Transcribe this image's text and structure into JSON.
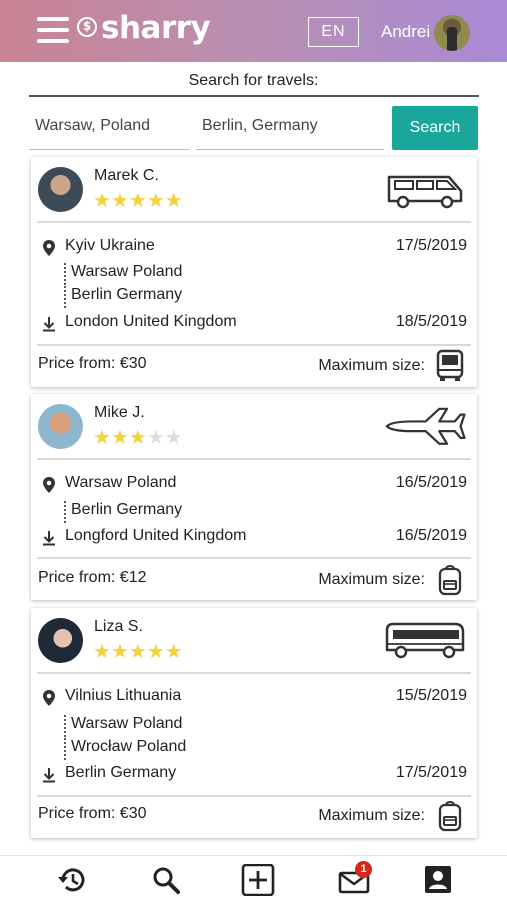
{
  "header": {
    "logo_text": "sharry",
    "logo_mark": "$",
    "language": "EN",
    "username": "Andrei"
  },
  "search": {
    "title": "Search for travels:",
    "from_value": "Warsaw, Poland",
    "to_value": "Berlin, Germany",
    "button_label": "Search",
    "button_color": "#1aa79b"
  },
  "trips": [
    {
      "driver": "Marek C.",
      "rating": 5,
      "vehicle_icon": "van-icon",
      "start": {
        "place": "Kyiv Ukraine",
        "date": "17/5/2019"
      },
      "stops": [
        "Warsaw Poland",
        "Berlin Germany"
      ],
      "end": {
        "place": "London United Kingdom",
        "date": "18/5/2019"
      },
      "price_label": "Price from: €30",
      "max_size_label": "Maximum size:",
      "size_icon": "van-front-icon"
    },
    {
      "driver": "Mike J.",
      "rating": 3,
      "vehicle_icon": "airplane-icon",
      "start": {
        "place": "Warsaw Poland",
        "date": "16/5/2019"
      },
      "stops": [
        "Berlin Germany"
      ],
      "end": {
        "place": "Longford United Kingdom",
        "date": "16/5/2019"
      },
      "price_label": "Price from: €12",
      "max_size_label": "Maximum size:",
      "size_icon": "backpack-icon"
    },
    {
      "driver": "Liza S.",
      "rating": 5,
      "vehicle_icon": "bus-icon",
      "start": {
        "place": "Vilnius Lithuania",
        "date": "15/5/2019"
      },
      "stops": [
        "Warsaw Poland",
        "Wrocław Poland"
      ],
      "end": {
        "place": "Berlin Germany",
        "date": "17/5/2019"
      },
      "price_label": "Price from: €30",
      "max_size_label": "Maximum size:",
      "size_icon": "backpack-icon"
    }
  ],
  "bottom_nav": {
    "items": [
      "history-icon",
      "search-icon",
      "add-icon",
      "mail-icon",
      "profile-icon"
    ],
    "mail_badge": "1"
  },
  "colors": {
    "header_gradient_start": "#c98394",
    "header_gradient_end": "#a98ad6",
    "star": "#f2d23e",
    "badge": "#d9261c"
  }
}
